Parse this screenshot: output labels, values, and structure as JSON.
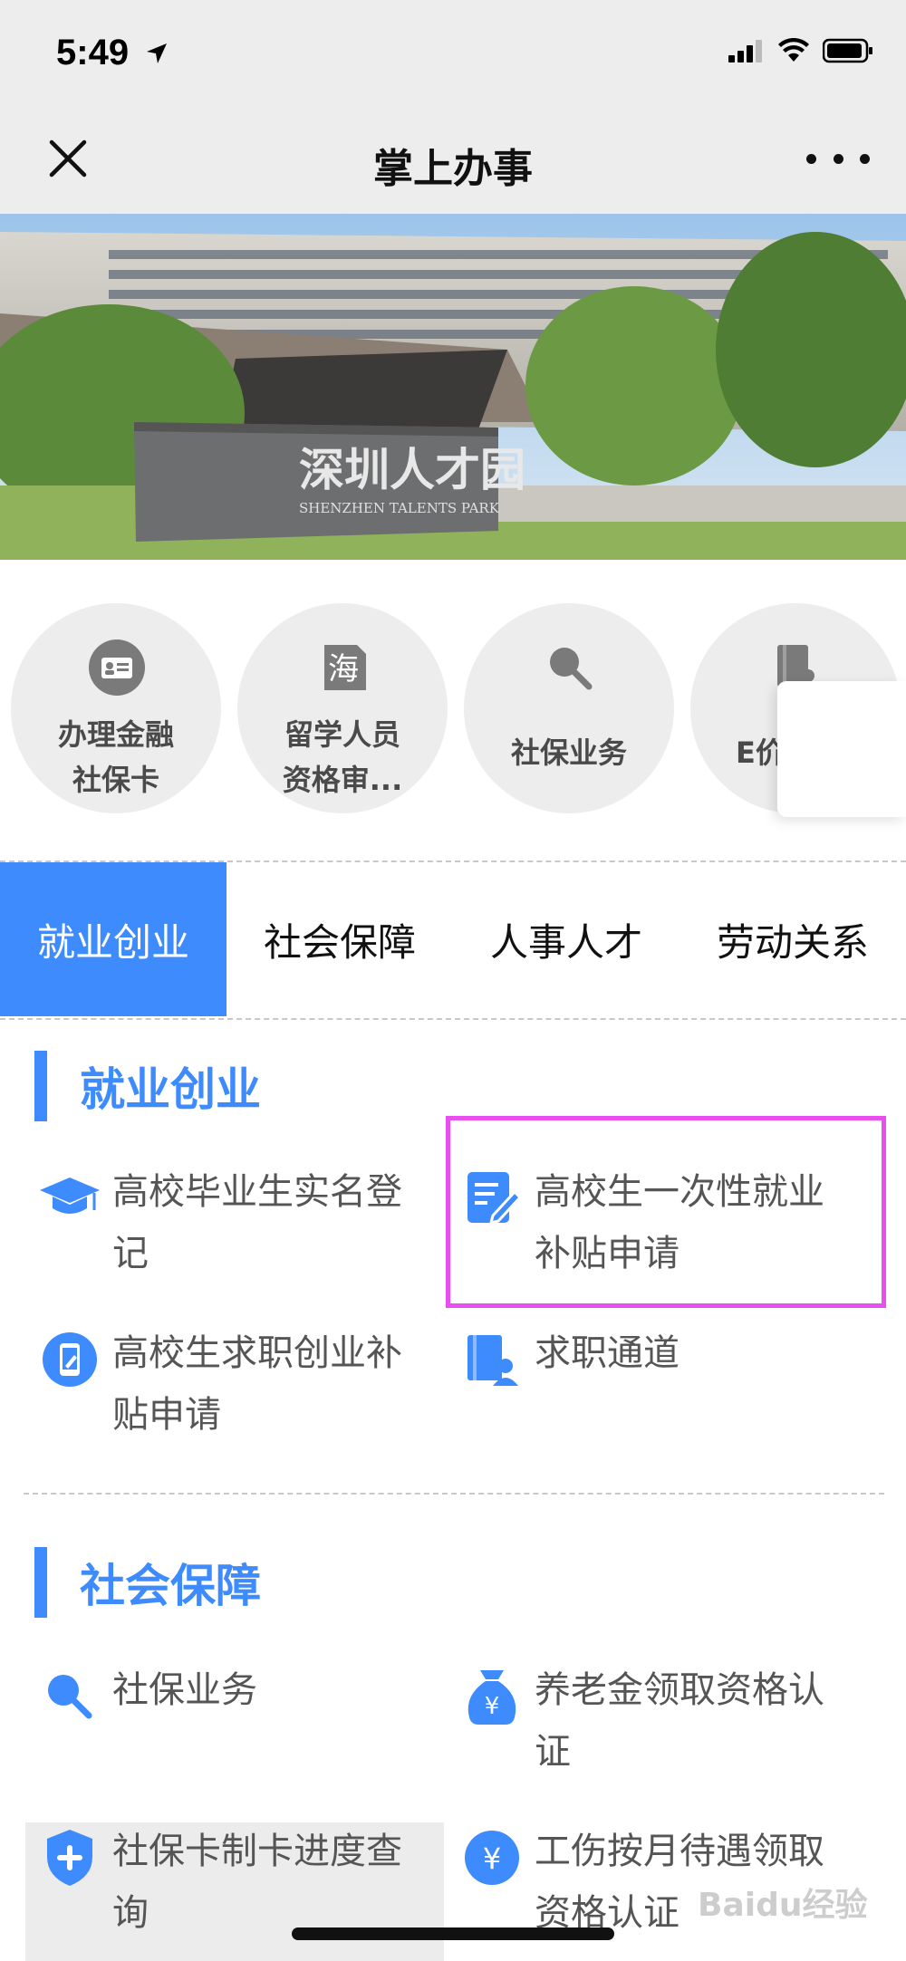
{
  "status": {
    "time": "5:49"
  },
  "nav": {
    "title": "掌上办事"
  },
  "banner": {
    "sign_cn": "深圳人才园",
    "sign_en": "SHENZHEN TALENTS PARK"
  },
  "quick": [
    {
      "label": "办理金融\n社保卡",
      "icon": "id-card-icon"
    },
    {
      "label": "留学人员\n资格审...",
      "icon": "hai-char-icon",
      "glyph": "海"
    },
    {
      "label": "社保业务",
      "icon": "search-icon"
    },
    {
      "label": "E价",
      "icon": "book-person-icon"
    }
  ],
  "tabs": [
    "就业创业",
    "社会保障",
    "人事人才",
    "劳动关系"
  ],
  "sections": [
    {
      "title": "就业创业",
      "items": [
        {
          "label": "高校毕业生实名登\n记",
          "icon": "graduation-cap-icon"
        },
        {
          "label": "高校生一次性就业\n补贴申请",
          "icon": "edit-doc-icon"
        },
        {
          "label": "高校生求职创业补\n贴申请",
          "icon": "phone-edit-icon"
        },
        {
          "label": "求职通道",
          "icon": "book-person-icon"
        }
      ]
    },
    {
      "title": "社会保障",
      "items": [
        {
          "label": "社保业务",
          "icon": "search-icon"
        },
        {
          "label": "养老金领取资格认\n证",
          "icon": "money-bag-icon"
        },
        {
          "label": "社保卡制卡进度查\n询",
          "icon": "shield-plus-icon"
        },
        {
          "label": "工伤按月待遇领取\n资格认证",
          "icon": "yuan-coin-icon"
        }
      ]
    }
  ],
  "watermark": "Baidu经验"
}
